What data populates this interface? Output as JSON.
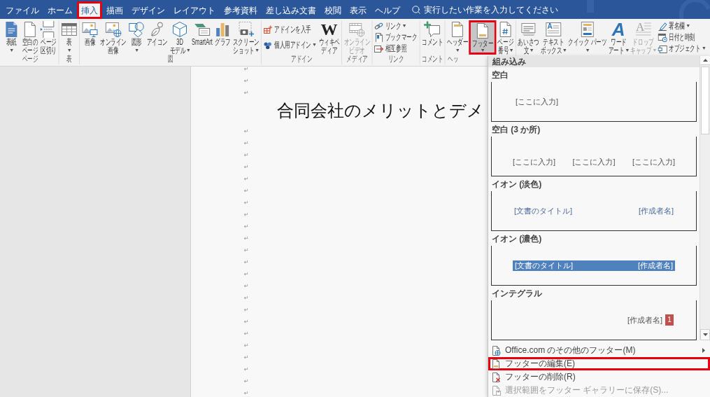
{
  "tabs": [
    {
      "label": "ファイル",
      "selected": false,
      "highlighted": false
    },
    {
      "label": "ホーム",
      "selected": false,
      "highlighted": false
    },
    {
      "label": "挿入",
      "selected": true,
      "highlighted": true
    },
    {
      "label": "描画",
      "selected": false,
      "highlighted": false
    },
    {
      "label": "デザイン",
      "selected": false,
      "highlighted": false
    },
    {
      "label": "レイアウト",
      "selected": false,
      "highlighted": false
    },
    {
      "label": "参考資料",
      "selected": false,
      "highlighted": false
    },
    {
      "label": "差し込み文書",
      "selected": false,
      "highlighted": false
    },
    {
      "label": "校閲",
      "selected": false,
      "highlighted": false
    },
    {
      "label": "表示",
      "selected": false,
      "highlighted": false
    },
    {
      "label": "ヘルプ",
      "selected": false,
      "highlighted": false
    }
  ],
  "search": {
    "placeholder": "実行したい作業を入力してください"
  },
  "ribbon": {
    "groups": [
      {
        "label": "ページ",
        "kind": "plain",
        "items": [
          {
            "kind": "large",
            "lines": [
              "表紙"
            ],
            "dropdown": true,
            "disabled": false,
            "selected": false,
            "highlighted": false
          },
          {
            "kind": "large",
            "lines": [
              "空白の",
              "ページ"
            ],
            "dropdown": false,
            "disabled": false,
            "selected": false,
            "highlighted": false
          },
          {
            "kind": "large",
            "lines": [
              "ページ",
              "区切り"
            ],
            "dropdown": false,
            "disabled": false,
            "selected": false,
            "highlighted": false
          }
        ]
      },
      {
        "label": "表",
        "kind": "plain",
        "items": [
          {
            "kind": "large",
            "lines": [
              "表"
            ],
            "dropdown": true,
            "disabled": false,
            "selected": false,
            "highlighted": false
          }
        ]
      },
      {
        "label": "図",
        "kind": "plain",
        "items": [
          {
            "kind": "large",
            "lines": [
              "画像"
            ],
            "dropdown": false,
            "disabled": false,
            "selected": false,
            "highlighted": false
          },
          {
            "kind": "large",
            "lines": [
              "オンライン",
              "画像"
            ],
            "dropdown": false,
            "disabled": false,
            "selected": false,
            "highlighted": false
          },
          {
            "kind": "large",
            "lines": [
              "図形"
            ],
            "dropdown": true,
            "disabled": false,
            "selected": false,
            "highlighted": false
          },
          {
            "kind": "large",
            "lines": [
              "アイコン"
            ],
            "dropdown": false,
            "disabled": false,
            "selected": false,
            "highlighted": false
          },
          {
            "kind": "large",
            "lines": [
              "3D",
              "モデル"
            ],
            "dropdown": true,
            "disabled": false,
            "selected": false,
            "highlighted": false
          },
          {
            "kind": "large",
            "lines": [
              "SmartArt"
            ],
            "dropdown": false,
            "disabled": false,
            "selected": false,
            "highlighted": false
          },
          {
            "kind": "large",
            "lines": [
              "グラフ"
            ],
            "dropdown": false,
            "disabled": false,
            "selected": false,
            "highlighted": false
          },
          {
            "kind": "large",
            "lines": [
              "スクリーン",
              "ショット"
            ],
            "dropdown": true,
            "disabled": false,
            "selected": false,
            "highlighted": false
          }
        ]
      },
      {
        "label": "アドイン",
        "kind": "plain",
        "items": [
          {
            "kind": "stack",
            "rows": [
              {
                "label": "アドインを入手",
                "dropdown": false,
                "disabled": false
              },
              {
                "label": "個人用アドイン",
                "dropdown": true,
                "disabled": false
              }
            ]
          },
          {
            "kind": "large",
            "icon_text": "W",
            "lines": [
              "ウィキペ",
              "ディア"
            ],
            "dropdown": false,
            "disabled": false,
            "selected": false,
            "highlighted": false
          }
        ]
      },
      {
        "label": "メディア",
        "kind": "plain",
        "items": [
          {
            "kind": "large",
            "lines": [
              "オンライン",
              "ビデオ"
            ],
            "dropdown": false,
            "disabled": true,
            "selected": false,
            "highlighted": false
          }
        ]
      },
      {
        "label": "リンク",
        "kind": "plain",
        "items": [
          {
            "kind": "stack",
            "rows": [
              {
                "label": "リンク",
                "dropdown": true,
                "disabled": false
              },
              {
                "label": "ブックマーク",
                "dropdown": false,
                "disabled": false
              },
              {
                "label": "相互参照",
                "dropdown": false,
                "disabled": false
              }
            ]
          }
        ]
      },
      {
        "label": "コメント",
        "kind": "plain",
        "items": [
          {
            "kind": "large",
            "lines": [
              "コメント"
            ],
            "dropdown": false,
            "disabled": false,
            "selected": false,
            "highlighted": false
          }
        ]
      },
      {
        "label": "ヘッ",
        "kind": "clipped",
        "items": [
          {
            "kind": "large",
            "lines": [
              "ヘッダー"
            ],
            "dropdown": true,
            "disabled": false,
            "selected": false,
            "highlighted": false
          },
          {
            "kind": "large",
            "lines": [
              "フッター"
            ],
            "dropdown": true,
            "disabled": false,
            "selected": true,
            "highlighted": true
          },
          {
            "kind": "large",
            "lines": [
              "ページ",
              "番号"
            ],
            "dropdown": true,
            "disabled": false,
            "selected": false,
            "highlighted": false
          }
        ]
      },
      {
        "items": [
          {
            "kind": "large",
            "lines": [
              "あいさつ",
              "文"
            ],
            "dropdown": true,
            "disabled": false,
            "selected": false,
            "highlighted": false
          },
          {
            "kind": "large",
            "icon_text": "A",
            "lines": [
              "テキスト",
              "ボックス"
            ],
            "dropdown": true,
            "disabled": false,
            "selected": false,
            "highlighted": false
          },
          {
            "kind": "large",
            "lines": [
              "クイック パーツ"
            ],
            "dropdown": true,
            "disabled": false,
            "selected": false,
            "highlighted": false
          },
          {
            "kind": "large",
            "icon_text": "A",
            "lines": [
              "ワード",
              "アート"
            ],
            "dropdown": true,
            "disabled": false,
            "selected": false,
            "highlighted": false
          },
          {
            "kind": "large",
            "icon_text": "A",
            "lines": [
              "ドロップ",
              "キャップ"
            ],
            "dropdown": true,
            "disabled": true,
            "selected": false,
            "highlighted": false
          },
          {
            "kind": "stack",
            "rows": [
              {
                "label": "署名欄",
                "dropdown": true,
                "disabled": false
              },
              {
                "label": "日付と時刻",
                "dropdown": false,
                "disabled": false
              },
              {
                "label": "オブジェクト",
                "dropdown": true,
                "disabled": false
              }
            ]
          }
        ]
      }
    ]
  },
  "gallery": {
    "heading": "組み込み",
    "items": [
      {
        "name": "空白",
        "kind": "blank",
        "fields": [
          "[ここに入力]"
        ]
      },
      {
        "name": "空白 (3 か所)",
        "kind": "blank3",
        "fields": [
          "[ここに入力]",
          "[ここに入力]",
          "[ここに入力]"
        ]
      },
      {
        "name": "イオン (淡色)",
        "kind": "ion_light",
        "fields": [
          "[文書のタイトル]",
          "[作成者名]"
        ]
      },
      {
        "name": "イオン (濃色)",
        "kind": "ion_dark",
        "fields": [
          "[文書のタイトル]",
          "[作成者名]"
        ]
      },
      {
        "name": "インテグラル",
        "kind": "integral",
        "fields": [
          "[作成者名]",
          "1"
        ]
      }
    ]
  },
  "menu": [
    {
      "label": "Office.com のその他のフッター(M)",
      "submenu": true,
      "disabled": false,
      "highlighted": false
    },
    {
      "label": "フッターの編集(E)",
      "submenu": false,
      "disabled": false,
      "highlighted": true
    },
    {
      "label": "フッターの削除(R)",
      "submenu": false,
      "disabled": false,
      "highlighted": false
    },
    {
      "label": "選択範囲をフッター ギャラリーに保存(S)...",
      "submenu": false,
      "disabled": true,
      "highlighted": false
    }
  ],
  "document": {
    "marks_before": [
      "↵",
      "↵",
      "↵"
    ],
    "title": "合同会社のメリットとデメ",
    "marks_after": [
      "↵",
      "↵",
      "↵",
      "↵",
      "↵",
      "↵",
      "↵",
      "↵",
      "↵",
      "↵",
      "↵",
      "↵",
      "↵",
      "↵",
      "↵",
      "↵",
      "↵",
      "↵",
      "↵",
      "↵",
      "↵",
      "↵",
      "↵"
    ]
  }
}
